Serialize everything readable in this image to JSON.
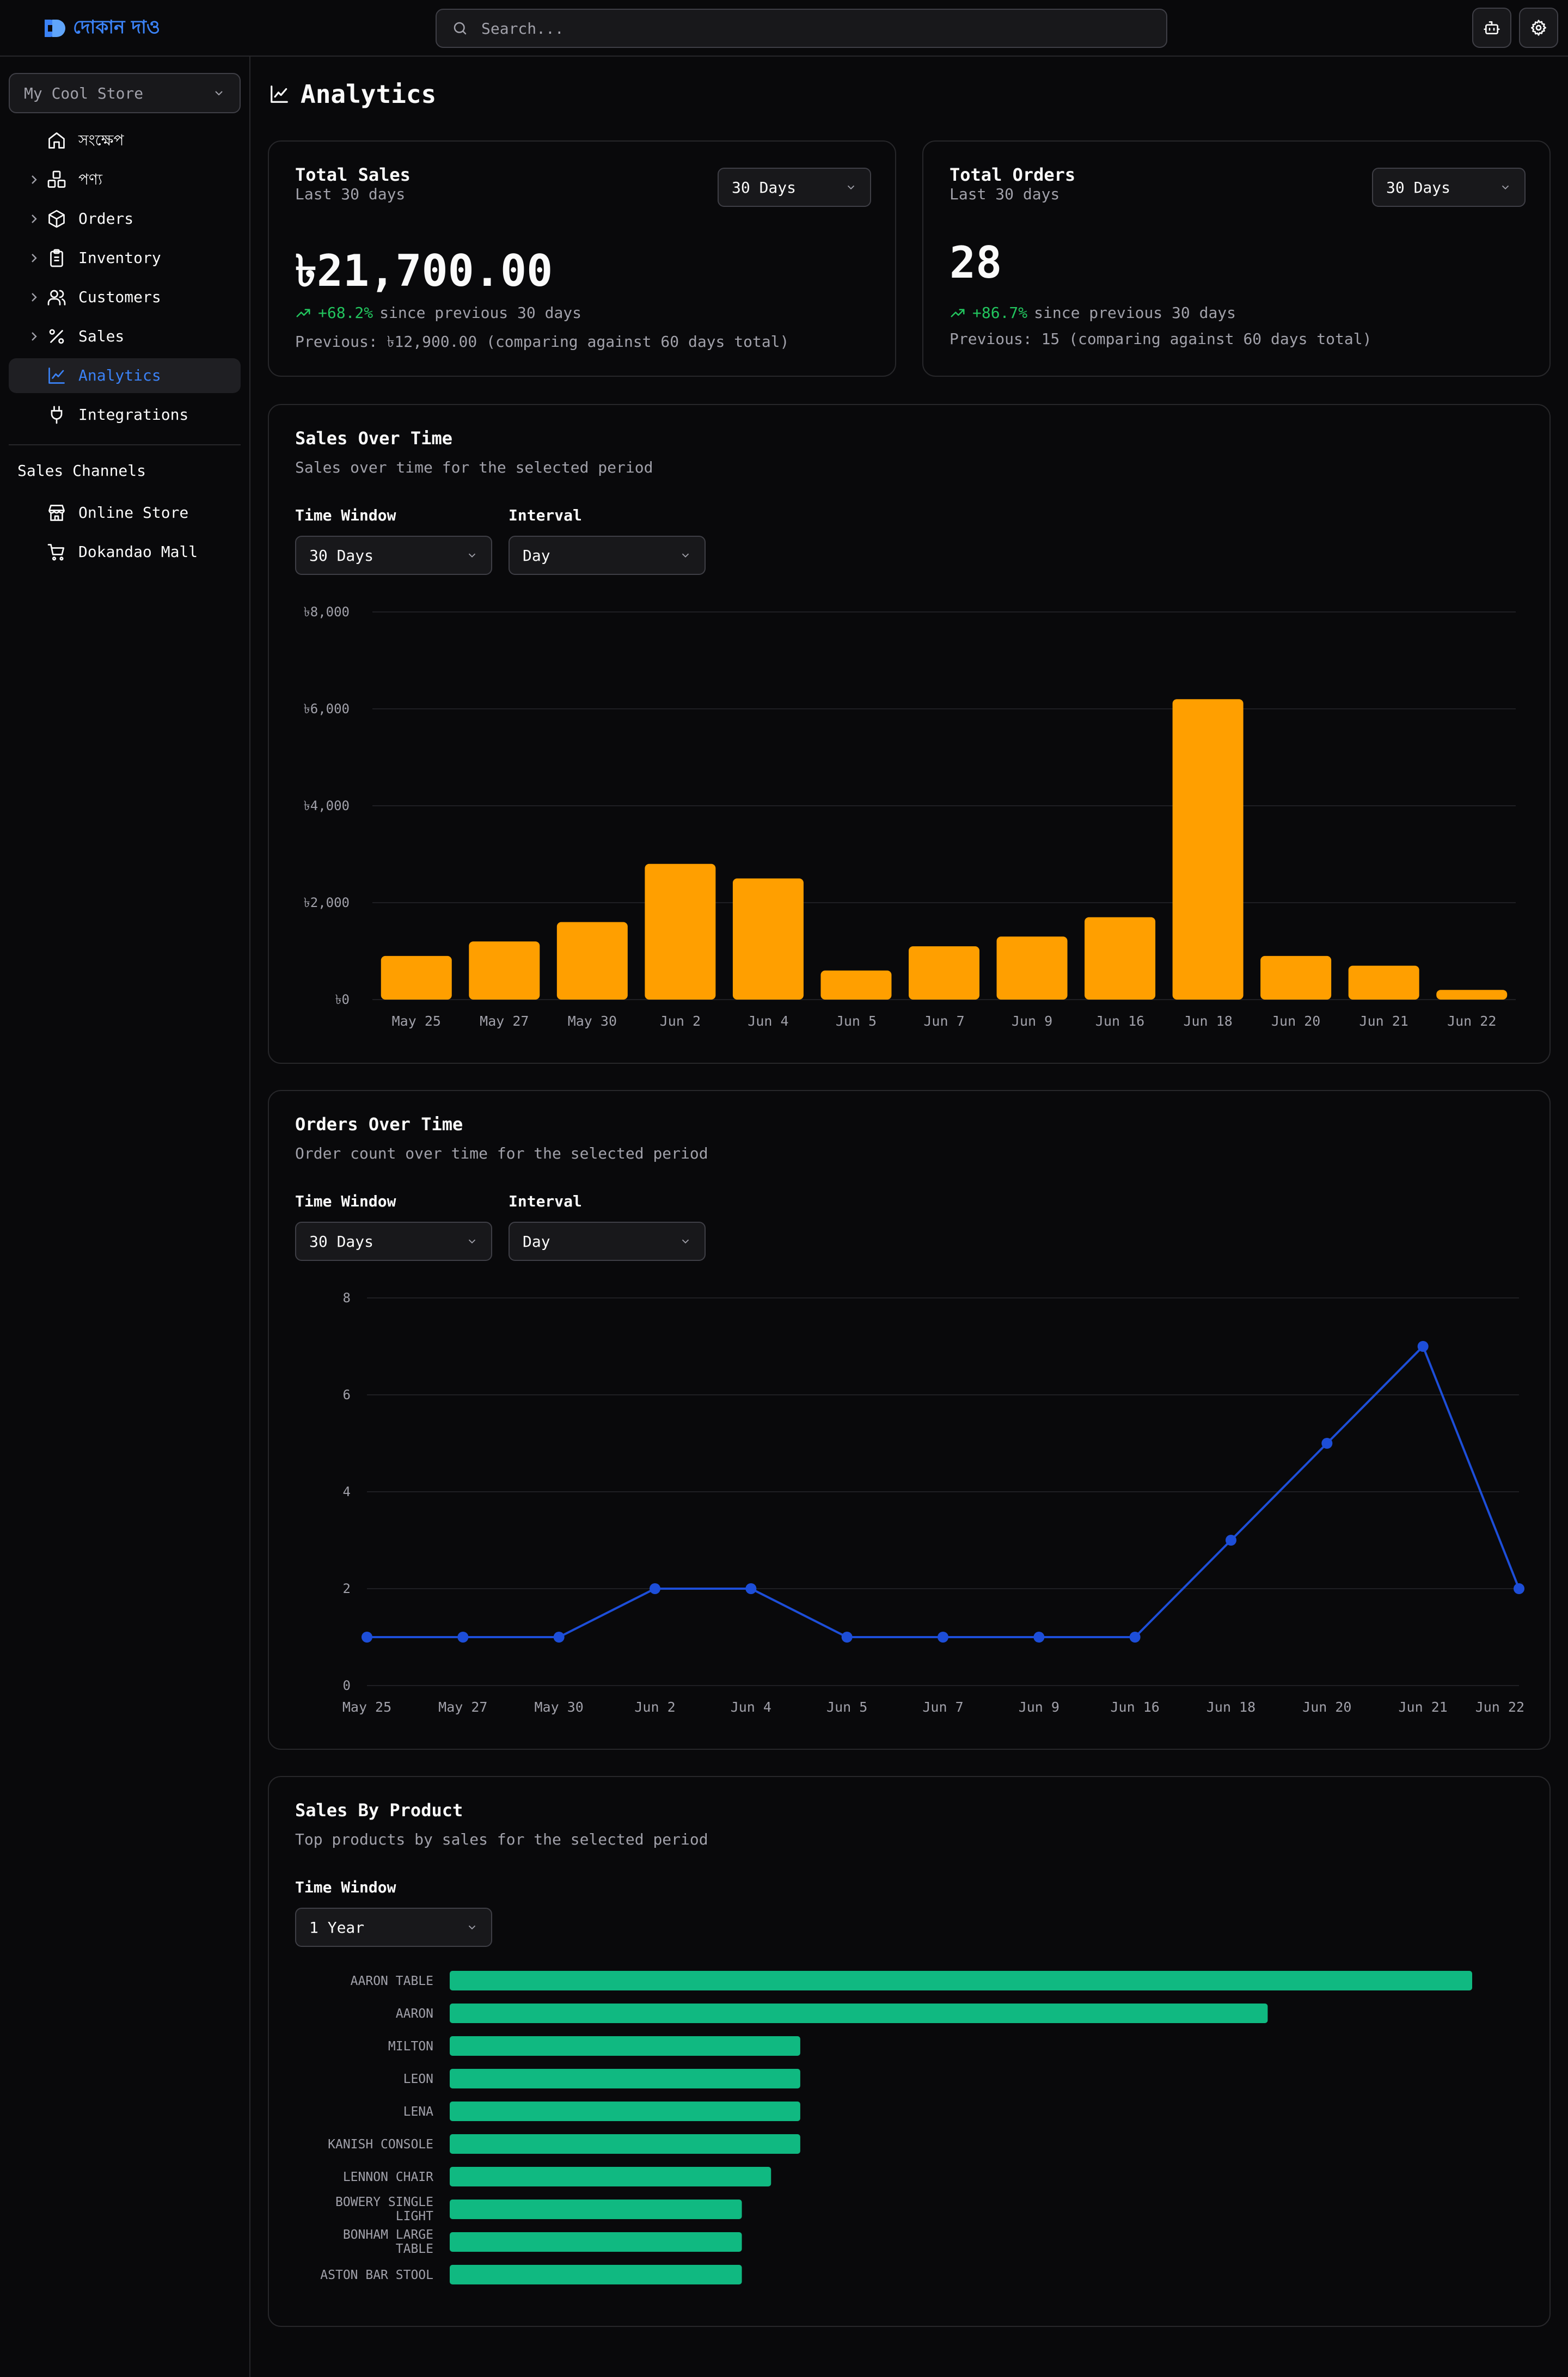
{
  "brand": {
    "name": "দোকান দাও",
    "accent": "#3b82f6"
  },
  "search": {
    "placeholder": "Search..."
  },
  "header_actions": [
    {
      "icon": "bot-icon"
    },
    {
      "icon": "gear-icon"
    }
  ],
  "sidebar": {
    "store": "My Cool Store",
    "items": [
      {
        "label": "সংক্ষেপ",
        "icon": "home-icon",
        "expandable": false,
        "active": false
      },
      {
        "label": "পণ্য",
        "icon": "boxes-icon",
        "expandable": true,
        "active": false
      },
      {
        "label": "Orders",
        "icon": "package-icon",
        "expandable": true,
        "active": false
      },
      {
        "label": "Inventory",
        "icon": "clipboard-icon",
        "expandable": true,
        "active": false
      },
      {
        "label": "Customers",
        "icon": "users-icon",
        "expandable": true,
        "active": false
      },
      {
        "label": "Sales",
        "icon": "percent-icon",
        "expandable": true,
        "active": false
      },
      {
        "label": "Analytics",
        "icon": "chart-line-icon",
        "expandable": false,
        "active": true
      },
      {
        "label": "Integrations",
        "icon": "plug-icon",
        "expandable": false,
        "active": false
      }
    ],
    "channels_title": "Sales Channels",
    "channels": [
      {
        "label": "Online Store",
        "icon": "store-icon"
      },
      {
        "label": "Dokandao Mall",
        "icon": "cart-icon"
      }
    ]
  },
  "page": {
    "title": "Analytics"
  },
  "stats": [
    {
      "title": "Total Sales",
      "subtitle": "Last 30 days",
      "range": "30 Days",
      "value": "৳21,700.00",
      "change": "+68.2%",
      "change_text": "since previous 30 days",
      "previous": "Previous: ৳12,900.00 (comparing against 60 days total)"
    },
    {
      "title": "Total Orders",
      "subtitle": "Last 30 days",
      "range": "30 Days",
      "value": "28",
      "change": "+86.7%",
      "change_text": "since previous 30 days",
      "previous": "Previous: 15 (comparing against 60 days total)"
    }
  ],
  "sales_chart": {
    "title": "Sales Over Time",
    "subtitle": "Sales over time for the selected period",
    "time_window_label": "Time Window",
    "time_window": "30 Days",
    "interval_label": "Interval",
    "interval": "Day"
  },
  "orders_chart": {
    "title": "Orders Over Time",
    "subtitle": "Order count over time for the selected period",
    "time_window_label": "Time Window",
    "time_window": "30 Days",
    "interval_label": "Interval",
    "interval": "Day"
  },
  "product_chart": {
    "title": "Sales By Product",
    "subtitle": "Top products by sales for the selected period",
    "time_window_label": "Time Window",
    "time_window": "1 Year"
  },
  "chart_data": [
    {
      "type": "bar",
      "categories": [
        "May 25",
        "May 27",
        "May 30",
        "Jun 2",
        "Jun 4",
        "Jun 5",
        "Jun 7",
        "Jun 9",
        "Jun 16",
        "Jun 18",
        "Jun 20",
        "Jun 21",
        "Jun 22"
      ],
      "values": [
        900,
        1200,
        1600,
        2800,
        2500,
        600,
        1100,
        1300,
        1700,
        6200,
        900,
        700,
        200
      ],
      "yticks": [
        "৳0",
        "৳2,000",
        "৳4,000",
        "৳6,000",
        "৳8,000"
      ],
      "ylim": [
        0,
        8000
      ],
      "color": "#ff9f00",
      "grid": true
    },
    {
      "type": "line",
      "categories": [
        "May 25",
        "May 27",
        "May 30",
        "Jun 2",
        "Jun 4",
        "Jun 5",
        "Jun 7",
        "Jun 9",
        "Jun 16",
        "Jun 18",
        "Jun 20",
        "Jun 21",
        "Jun 22"
      ],
      "values": [
        1,
        1,
        1,
        2,
        2,
        1,
        1,
        1,
        1,
        3,
        5,
        7,
        2
      ],
      "yticks": [
        "0",
        "2",
        "4",
        "6",
        "8"
      ],
      "ylim": [
        0,
        8
      ],
      "color": "#1d4ed8",
      "grid": true
    },
    {
      "type": "bar",
      "orientation": "horizontal",
      "categories": [
        "AARON TABLE",
        "AARON",
        "MILTON",
        "LEON",
        "LENA",
        "KANISH CONSOLE",
        "LENNON CHAIR",
        "BOWERY SINGLE LIGHT",
        "BONHAM LARGE TABLE",
        "ASTON BAR STOOL"
      ],
      "values": [
        35,
        28,
        12,
        12,
        12,
        12,
        11,
        10,
        10,
        10
      ],
      "xlim": [
        0,
        35
      ],
      "color": "#10b981"
    }
  ]
}
